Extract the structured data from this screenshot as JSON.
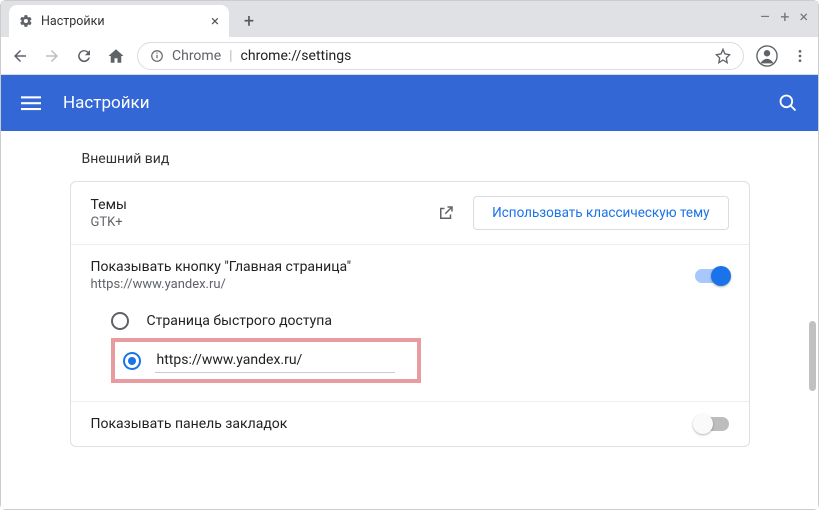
{
  "window": {
    "tab_title": "Настройки"
  },
  "omnibox": {
    "scheme": "Chrome",
    "path": "chrome://settings"
  },
  "header": {
    "title": "Настройки"
  },
  "appearance": {
    "section_title": "Внешний вид",
    "themes": {
      "title": "Темы",
      "subtitle": "GTK+",
      "button": "Использовать классическую тему"
    },
    "home_button": {
      "title": "Показывать кнопку \"Главная страница\"",
      "subtitle": "https://www.yandex.ru/",
      "option_ntp": "Страница быстрого доступа",
      "custom_url": "https://www.yandex.ru/"
    },
    "bookmarks_bar": {
      "title": "Показывать панель закладок"
    }
  }
}
